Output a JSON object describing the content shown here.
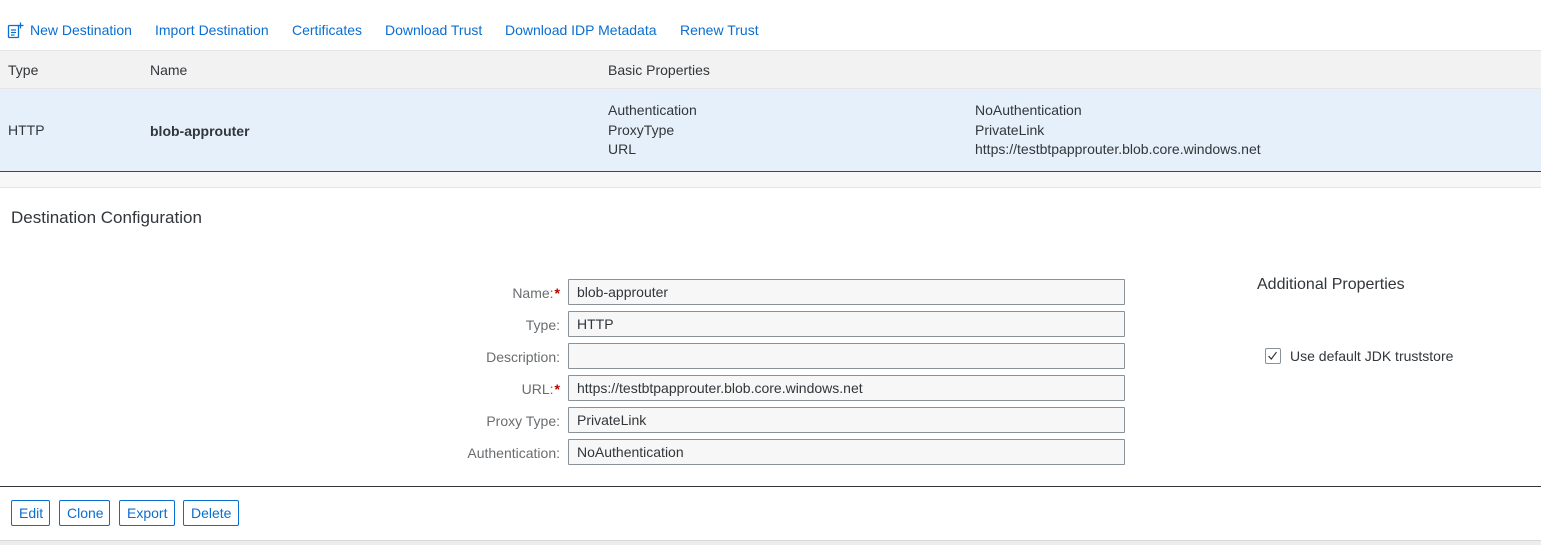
{
  "toolbar": {
    "new_destination": "New Destination",
    "import_destination": "Import Destination",
    "certificates": "Certificates",
    "download_trust": "Download Trust",
    "download_idp_metadata": "Download IDP Metadata",
    "renew_trust": "Renew Trust",
    "new_icon": "document-add-icon"
  },
  "table": {
    "headers": {
      "type": "Type",
      "name": "Name",
      "basic_properties": "Basic Properties"
    },
    "rows": [
      {
        "type": "HTTP",
        "name": "blob-approuter",
        "properties": [
          {
            "key": "Authentication",
            "value": "NoAuthentication"
          },
          {
            "key": "ProxyType",
            "value": "PrivateLink"
          },
          {
            "key": "URL",
            "value": "https://testbtpapprouter.blob.core.windows.net"
          }
        ]
      }
    ]
  },
  "config": {
    "title": "Destination Configuration",
    "fields": [
      {
        "label": "Name:",
        "required": true,
        "value": "blob-approuter"
      },
      {
        "label": "Type:",
        "required": false,
        "value": "HTTP"
      },
      {
        "label": "Description:",
        "required": false,
        "value": ""
      },
      {
        "label": "URL:",
        "required": true,
        "value": "https://testbtpapprouter.blob.core.windows.net"
      },
      {
        "label": "Proxy Type:",
        "required": false,
        "value": "PrivateLink"
      },
      {
        "label": "Authentication:",
        "required": false,
        "value": "NoAuthentication"
      }
    ],
    "required_marker": "*"
  },
  "additional_properties": {
    "title": "Additional Properties",
    "use_default_jdk_truststore": {
      "label": "Use default JDK truststore",
      "checked": true
    }
  },
  "actions": {
    "edit": "Edit",
    "clone": "Clone",
    "export": "Export",
    "delete": "Delete"
  },
  "colors": {
    "link": "#0a6ed1",
    "selected_row": "#e5f0fa",
    "required": "#bb0000"
  }
}
